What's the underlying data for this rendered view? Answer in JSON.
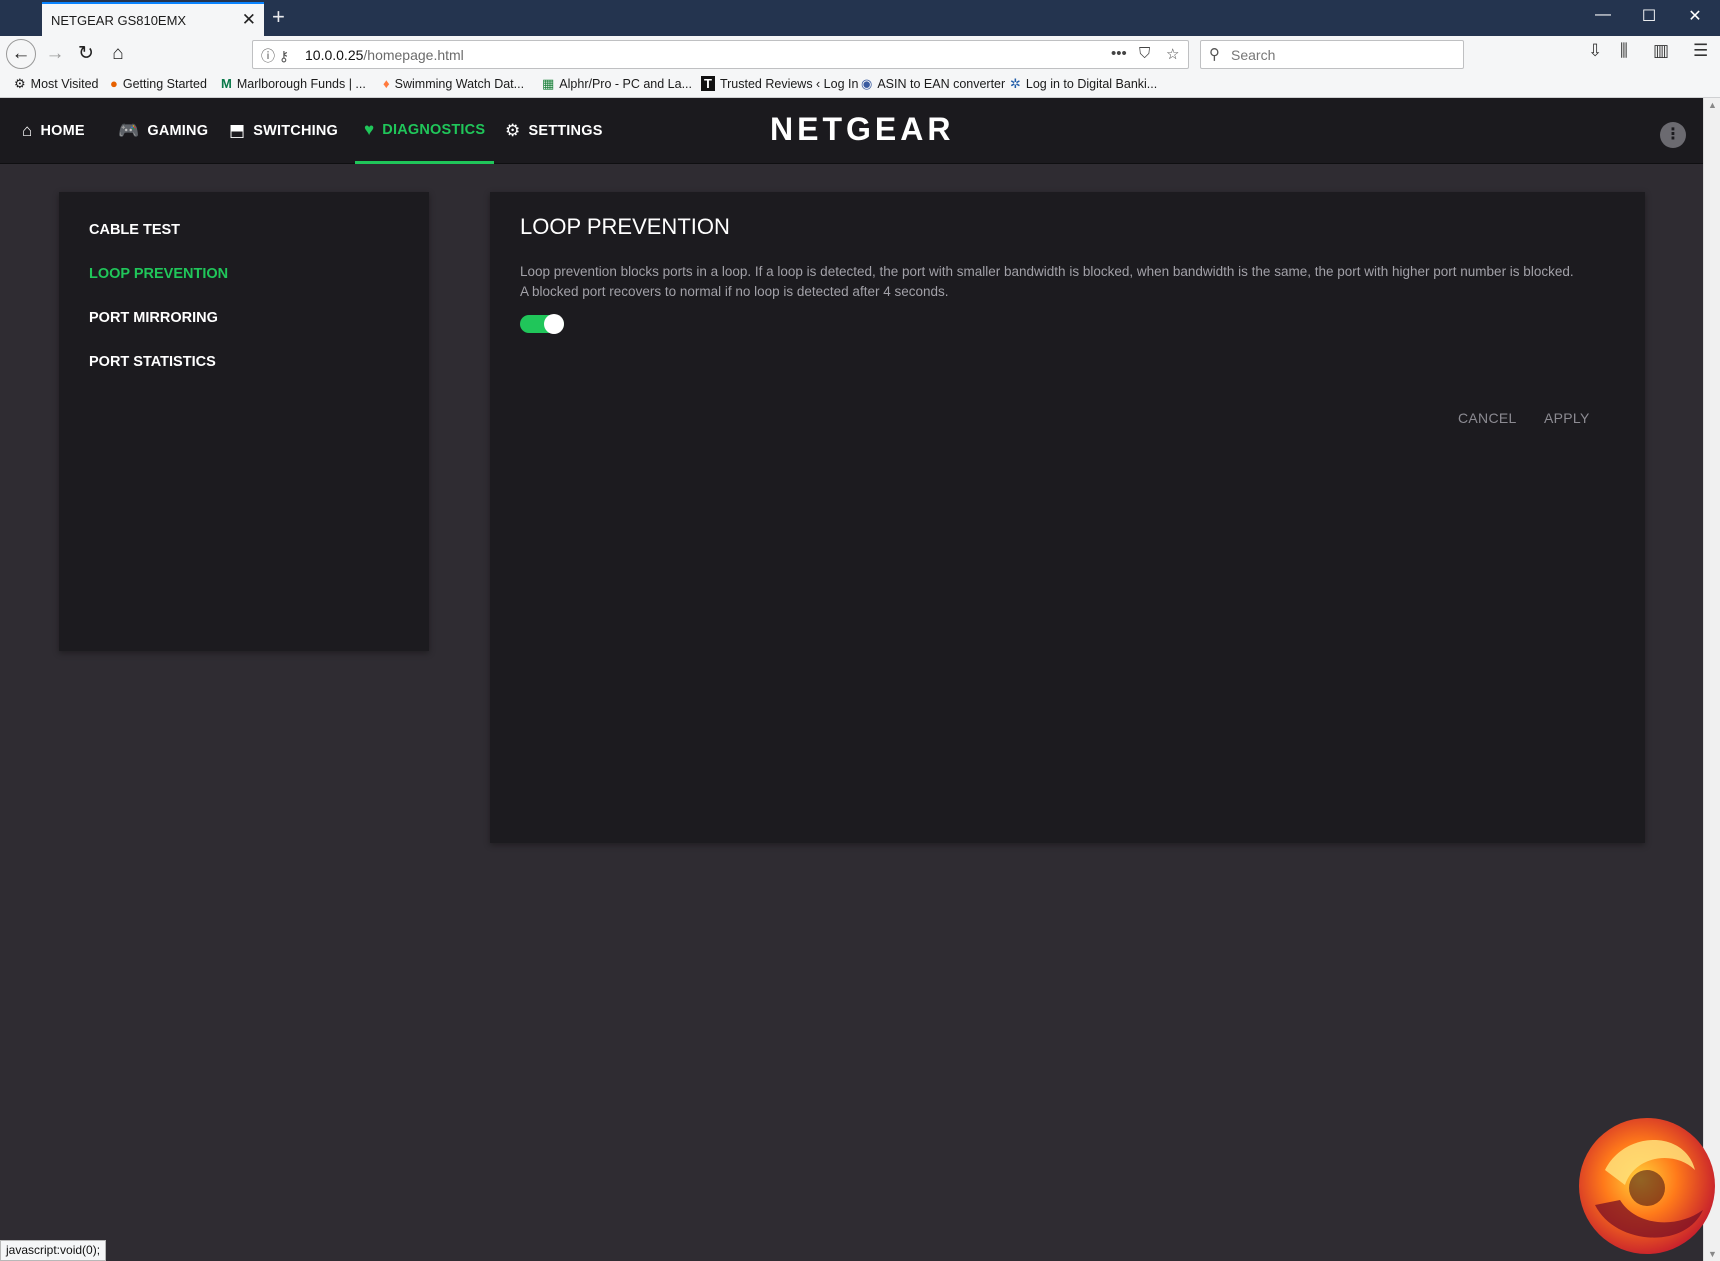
{
  "browser": {
    "tab_title": "NETGEAR GS810EMX",
    "url_host": "10.0.0.25",
    "url_path": "/homepage.html",
    "search_placeholder": "Search",
    "bookmarks": [
      {
        "label": "Most Visited",
        "icon": "gear-icon"
      },
      {
        "label": "Getting Started",
        "icon": "firefox-icon"
      },
      {
        "label": "Marlborough Funds | ...",
        "icon": "m-logo-icon"
      },
      {
        "label": "Swimming Watch Dat...",
        "icon": "pin-icon"
      },
      {
        "label": "Alphr/Pro - PC and La...",
        "icon": "sheet-icon"
      },
      {
        "label": "Trusted Reviews ‹ Log In",
        "icon": "t-logo-icon"
      },
      {
        "label": "ASIN to EAN converter",
        "icon": "globe-icon"
      },
      {
        "label": "Log in to Digital Banki...",
        "icon": "star-logo-icon"
      }
    ],
    "status_text": "javascript:void(0);"
  },
  "nav": {
    "items": [
      {
        "label": "HOME",
        "icon": "home-icon"
      },
      {
        "label": "GAMING",
        "icon": "gamepad-icon"
      },
      {
        "label": "SWITCHING",
        "icon": "switch-icon"
      },
      {
        "label": "DIAGNOSTICS",
        "icon": "heart-pulse-icon",
        "active": true
      },
      {
        "label": "SETTINGS",
        "icon": "gear-icon"
      }
    ],
    "brand": "NETGEAR",
    "accent_color": "#20c65a"
  },
  "sidebar": {
    "items": [
      {
        "label": "CABLE TEST"
      },
      {
        "label": "LOOP PREVENTION",
        "active": true
      },
      {
        "label": "PORT MIRRORING"
      },
      {
        "label": "PORT STATISTICS"
      }
    ]
  },
  "main": {
    "title": "LOOP PREVENTION",
    "description_line1": "Loop prevention blocks ports in a loop. If a loop is detected, the port with smaller bandwidth is blocked, when bandwidth is the same, the port with higher port number is blocked.",
    "description_line2": "A blocked port recovers to normal if no loop is detected after 4 seconds.",
    "toggle_on": true,
    "cancel_label": "CANCEL",
    "apply_label": "APPLY"
  }
}
